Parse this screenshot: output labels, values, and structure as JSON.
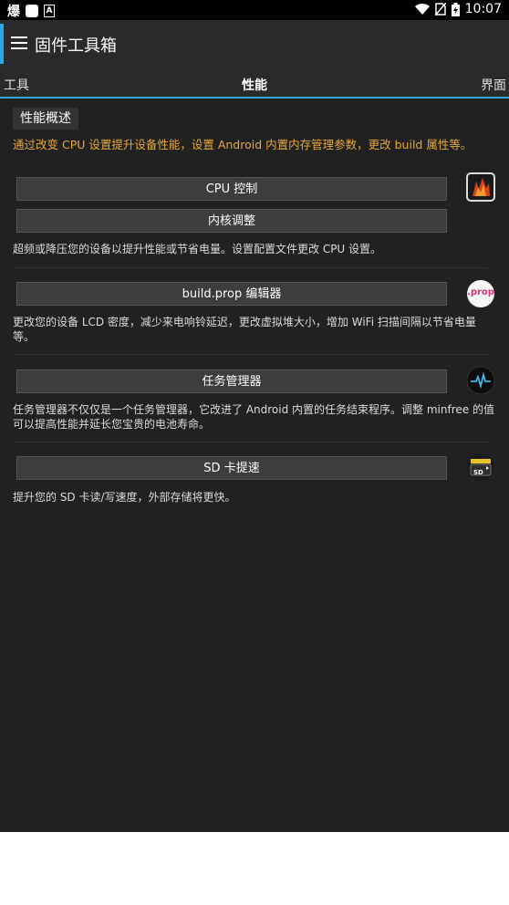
{
  "status": {
    "time": "10:07",
    "left_glyph": "爆"
  },
  "app": {
    "title": "固件工具箱"
  },
  "tabs": [
    {
      "label": "工具"
    },
    {
      "label": "性能"
    },
    {
      "label": "界面"
    }
  ],
  "section": {
    "title": "性能概述",
    "intro": "通过改变 CPU 设置提升设备性能，设置 Android 内置内存管理参数，更改 build 属性等。"
  },
  "items": [
    {
      "buttons": [
        "CPU 控制",
        "内核调整"
      ],
      "desc": "超频或降压您的设备以提升性能或节省电量。设置配置文件更改 CPU 设置。",
      "icon": "cpu-icon"
    },
    {
      "buttons": [
        "build.prop 编辑器"
      ],
      "desc": "更改您的设备 LCD 密度，减少来电响铃延迟，更改虚拟堆大小，增加 WiFi 扫描间隔以节省电量等。",
      "icon": "prop-icon",
      "icon_text": ".prop"
    },
    {
      "buttons": [
        "任务管理器"
      ],
      "desc": "任务管理器不仅仅是一个任务管理器，它改进了 Android 内置的任务结束程序。调整 minfree 的值可以提高性能并延长您宝贵的电池寿命。",
      "icon": "pulse-icon"
    },
    {
      "buttons": [
        "SD 卡提速"
      ],
      "desc": "提升您的 SD 卡读/写速度，外部存储将更快。",
      "icon": "sd-card-icon",
      "icon_text": "SD"
    }
  ]
}
